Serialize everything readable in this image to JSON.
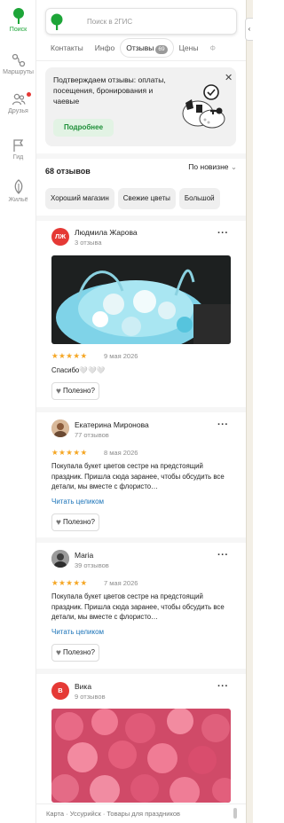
{
  "rail": {
    "items": [
      {
        "label": "Поиск",
        "icon": "search-pin-icon"
      },
      {
        "label": "Маршруты",
        "icon": "routes-icon"
      },
      {
        "label": "Друзья",
        "icon": "friends-icon"
      },
      {
        "label": "Гид",
        "icon": "guide-flag-icon"
      },
      {
        "label": "Жильё",
        "icon": "housing-icon"
      }
    ]
  },
  "search": {
    "placeholder": "Поиск в 2ГИС"
  },
  "tabs": [
    {
      "label": "Контакты"
    },
    {
      "label": "Инфо"
    },
    {
      "label": "Отзывы",
      "badge": "69"
    },
    {
      "label": "Цены"
    },
    {
      "label": "Ф"
    }
  ],
  "promo": {
    "text": "Подтверждаем отзывы: оплаты, посещения, бронирования и чаевые",
    "button": "Подробнее"
  },
  "reviews_header": {
    "count": "68 отзывов",
    "sort": "По новизне"
  },
  "chips": [
    "Хороший магазин",
    "Свежие цветы",
    "Большой"
  ],
  "reviews": [
    {
      "initials": "ЛЖ",
      "name": "Людмила Жарова",
      "count": "3 отзыва",
      "stars": "★★★★★",
      "date": "9 мая 2026",
      "text": "Спасибо🤍🤍🤍",
      "useful": "Полезно?"
    },
    {
      "name": "Екатерина Миронова",
      "count": "77 отзывов",
      "stars": "★★★★★",
      "date": "8 мая 2026",
      "text": "Покупала букет цветов сестре на предстоящий праздник. Пришла сюда заранее, чтобы обсудить все детали, мы вместе с флористо…",
      "readmore": "Читать целиком",
      "useful": "Полезно?"
    },
    {
      "name": "Maria",
      "count": "39 отзывов",
      "stars": "★★★★★",
      "date": "7 мая 2026",
      "text": "Покупала букет цветов сестре на предстоящий праздник. Пришла сюда заранее, чтобы обсудить все детали, мы вместе с флористо…",
      "readmore": "Читать целиком",
      "useful": "Полезно?"
    },
    {
      "initials": "В",
      "name": "Вика",
      "count": "9 отзывов"
    }
  ],
  "footer": {
    "crumbs": "Карта · Уссурийск · Товары для праздников"
  },
  "colors": {
    "brand_green": "#1da538",
    "star": "#f5a623",
    "link": "#1a73b8",
    "notification": "#e53935"
  }
}
